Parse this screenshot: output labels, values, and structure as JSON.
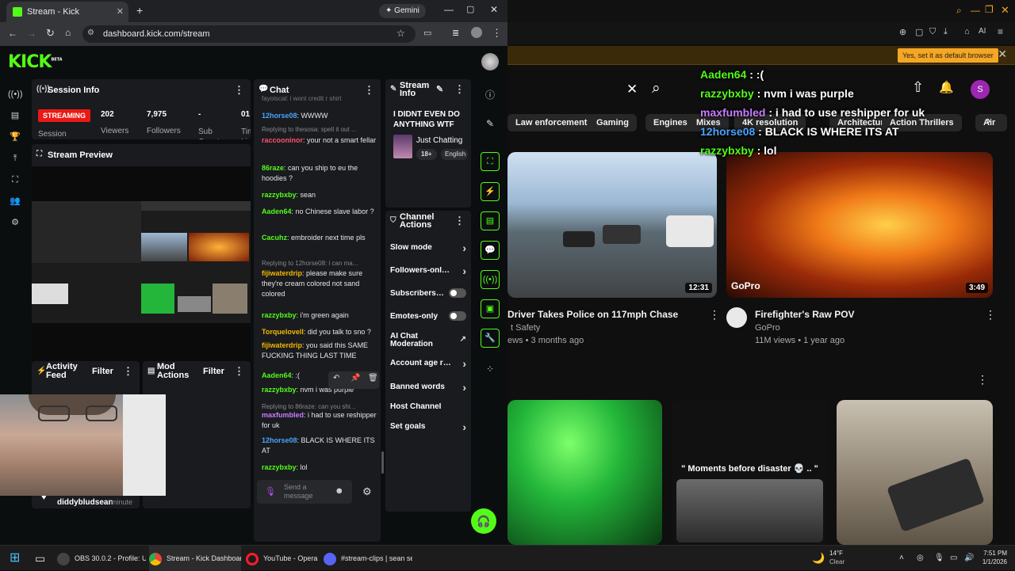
{
  "browser": {
    "tab_title": "Stream - Kick Dashboard",
    "new_tab": "+",
    "gemini": "Gemini",
    "url": "dashboard.kick.com/stream"
  },
  "kick": {
    "logo": "KICK",
    "logo_sup": "BETA",
    "session": {
      "title": "Session Info",
      "status": "STREAMING",
      "viewers_value": "202",
      "viewers_label": "Viewers",
      "followers_value": "7,975",
      "followers_label": "Followers",
      "subs_value": "-",
      "subs_label": "Sub Counts",
      "live_value": "01",
      "live_label": "Tim Liv",
      "session_label": "Session"
    },
    "preview_title": "Stream Preview",
    "activity": {
      "title": "Activity Feed",
      "filter": "Filter",
      "user": "diddybludsean",
      "time": "minute"
    },
    "mod": {
      "title": "Mod Actions",
      "filter": "Filter"
    },
    "chat": {
      "title": "Chat",
      "top_cut": "fayoiscal: i wont credit r shirt",
      "placeholder": "Send a message",
      "messages": [
        {
          "user": "12horse08",
          "color": "#4aa3ff",
          "text": "WWWW"
        },
        {
          "reply": "Replying to thesosa: spell it out ..."
        },
        {
          "user": "raccooninor",
          "color": "#ff4f6a",
          "text": "your not a smart fellar"
        },
        {
          "user": "86raze",
          "color": "#53fc18",
          "text": "can you ship to eu the hoodies ?"
        },
        {
          "user": "razzybxby",
          "color": "#53fc18",
          "text": "sean"
        },
        {
          "user": "Aaden64",
          "color": "#53fc18",
          "text": "no Chinese slave labor ?"
        },
        {
          "user": "Cacuhz",
          "color": "#53fc18",
          "text": "embroider next time pls"
        },
        {
          "reply": "Replying to 12horse08: i can ma..."
        },
        {
          "user": "fijiwaterdrip",
          "color": "#f5b800",
          "text": "please make sure they're cream colored not sand colored"
        },
        {
          "user": "razzybxby",
          "color": "#53fc18",
          "text": "i'm green again"
        },
        {
          "user": "Torquelovell",
          "color": "#f5b800",
          "text": "did you talk to sno ?"
        },
        {
          "user": "fijiwaterdrip",
          "color": "#f5b800",
          "text": "you said this SAME FUCKING THING LAST TIME"
        },
        {
          "user": "Aaden64",
          "color": "#53fc18",
          "text": ":("
        },
        {
          "user": "razzybxby",
          "color": "#53fc18",
          "text": "nvm i was purple"
        },
        {
          "reply": "Replying to 86raze: can you shi..."
        },
        {
          "user": "maxfumbled",
          "color": "#c77dff",
          "text": "i had to use reshipper for uk"
        },
        {
          "user": "12horse08",
          "color": "#4aa3ff",
          "text": "BLACK IS WHERE ITS AT"
        },
        {
          "user": "razzybxby",
          "color": "#53fc18",
          "text": "lol"
        }
      ]
    },
    "stream_info": {
      "title": "Stream Info",
      "stream_title": "I DIDNT EVEN DO ANYTHING WTF",
      "category": "Just Chatting",
      "tag1": "18+",
      "tag2": "English"
    },
    "channel_actions": {
      "title": "Channel Actions",
      "items": [
        "Slow mode",
        "Followers-only chat",
        "Subscribers-only",
        "Emotes-only",
        "AI Chat Moderation",
        "Account age restriction",
        "Banned words",
        "Host Channel",
        "Set goals"
      ]
    }
  },
  "youtube": {
    "notice_btn": "Yes, set it as default browser",
    "avatar": "S",
    "chips": [
      "Law enforcement",
      "Gaming",
      "Engines",
      "Mixes",
      "4K resolution",
      "Architecture",
      "Action Thrillers",
      "Air"
    ],
    "videos": [
      {
        "title": "Driver Takes Police on 117mph Chase",
        "channel": "t Safety",
        "meta": "ews • 3 months ago",
        "duration": "12:31"
      },
      {
        "title": "Firefighter's Raw POV",
        "channel": "GoPro",
        "meta": "11M views • 1 year ago",
        "duration": "3:49"
      }
    ],
    "short_caption": "\" Moments before disaster 💀 .. \"",
    "overlay": [
      {
        "user": "Aaden64",
        "color": "#53fc18",
        "text": " : :("
      },
      {
        "user": "razzybxby",
        "color": "#53fc18",
        "text": " : nvm i was purple"
      },
      {
        "user": "maxfumbled",
        "color": "#c77dff",
        "text": " : i had to use reshipper for uk"
      },
      {
        "user": "12horse08",
        "color": "#4aa3ff",
        "text": " : BLACK IS WHERE ITS AT"
      },
      {
        "user": "razzybxby",
        "color": "#53fc18",
        "text": " : lol"
      }
    ]
  },
  "taskbar": {
    "obs": "OBS 30.0.2 - Profile: Unt",
    "chrome": "Stream - Kick Dashboar",
    "opera": "YouTube - Opera",
    "discord": "#stream-clips | sean sea",
    "temp": "14°F",
    "weather": "Clear",
    "time": "7:51 PM",
    "date": "1/1/2026"
  }
}
